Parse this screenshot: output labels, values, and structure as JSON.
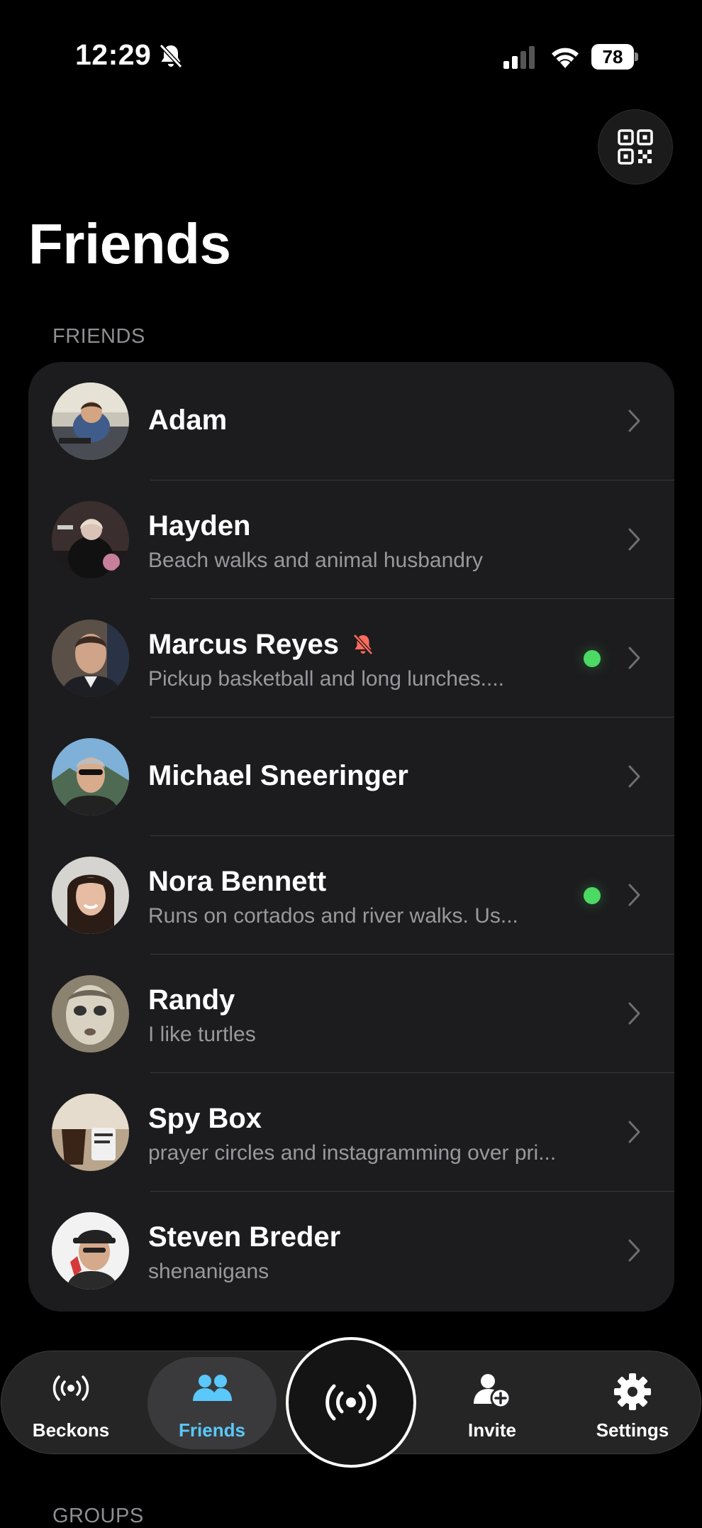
{
  "status_bar": {
    "time": "12:29",
    "battery": "78"
  },
  "page": {
    "title": "Friends"
  },
  "sections": {
    "friends": "FRIENDS",
    "groups": "GROUPS"
  },
  "friends": [
    {
      "name": "Adam",
      "status": "",
      "online": false,
      "muted": false
    },
    {
      "name": "Hayden",
      "status": "Beach walks and animal husbandry",
      "online": false,
      "muted": false
    },
    {
      "name": "Marcus Reyes",
      "status": "Pickup basketball and long lunches....",
      "online": true,
      "muted": true
    },
    {
      "name": "Michael Sneeringer",
      "status": "",
      "online": false,
      "muted": false
    },
    {
      "name": "Nora Bennett",
      "status": "Runs on cortados and river walks. Us...",
      "online": true,
      "muted": false
    },
    {
      "name": "Randy",
      "status": "I like turtles",
      "online": false,
      "muted": false
    },
    {
      "name": "Spy Box",
      "status": "prayer circles and instagramming over pri...",
      "online": false,
      "muted": false
    },
    {
      "name": "Steven Breder",
      "status": "shenanigans",
      "online": false,
      "muted": false
    }
  ],
  "tab_bar": {
    "beckons": "Beckons",
    "friends": "Friends",
    "invite": "Invite",
    "settings": "Settings",
    "active": "friends"
  },
  "colors": {
    "accent": "#5ac8fa",
    "online": "#4cd964",
    "muted_bell": "#ff6b5b",
    "card": "#1c1c1e"
  }
}
